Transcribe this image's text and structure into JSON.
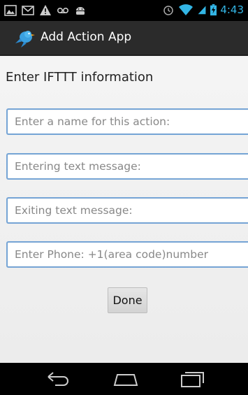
{
  "status_bar": {
    "time": "4:43",
    "left_icons": [
      "picture-icon",
      "gmail-icon",
      "warning-icon",
      "voicemail-icon",
      "android-icon"
    ],
    "right_icons": [
      "alarm-icon",
      "wifi-icon",
      "signal-icon",
      "battery-icon"
    ]
  },
  "action_bar": {
    "title": "Add Action App",
    "icon": "bird-app-icon"
  },
  "form": {
    "heading": "Enter IFTTT information",
    "fields": [
      {
        "placeholder": "Enter a name for this action:",
        "value": ""
      },
      {
        "placeholder": "Entering text message:",
        "value": ""
      },
      {
        "placeholder": "Exiting text message:",
        "value": ""
      },
      {
        "placeholder": "Enter Phone: +1(area code)number",
        "value": ""
      }
    ],
    "done_label": "Done"
  },
  "nav_bar": {
    "buttons": [
      "back-icon",
      "home-icon",
      "recents-icon"
    ]
  },
  "colors": {
    "accent": "#33b5e5",
    "field_border": "#76a5d6",
    "action_bar": "#2b2b2b"
  }
}
